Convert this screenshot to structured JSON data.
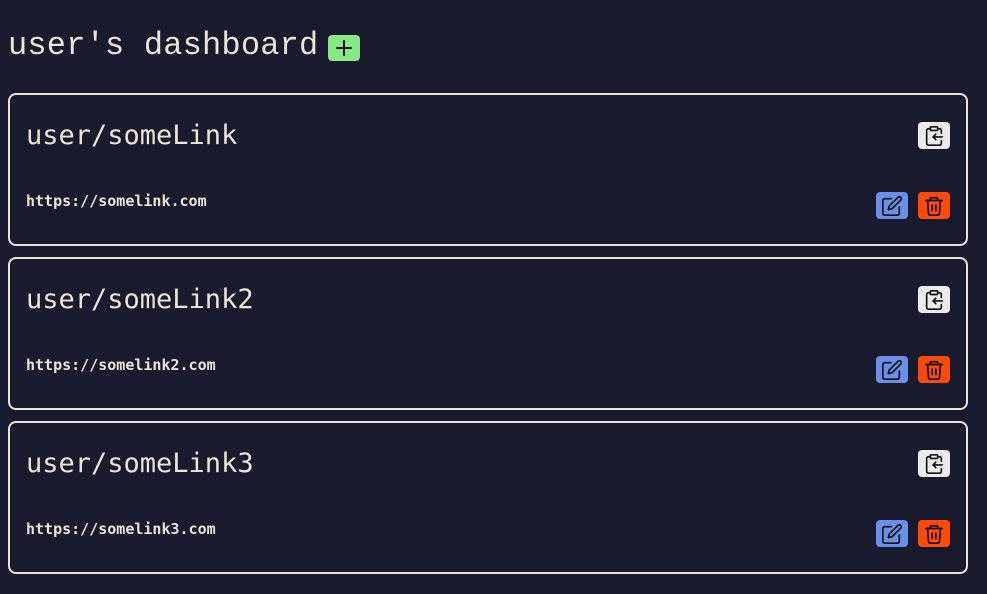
{
  "header": {
    "title": "user's dashboard",
    "add_icon": "plus-icon",
    "add_color": "#86e887"
  },
  "colors": {
    "background": "#1a1a2e",
    "text": "#ece4d4",
    "copy": "#ececec",
    "edit": "#6a8fe8",
    "delete": "#fc4a0a"
  },
  "links": [
    {
      "title": "user/someLink",
      "url": "https://somelink.com"
    },
    {
      "title": "user/someLink2",
      "url": "https://somelink2.com"
    },
    {
      "title": "user/someLink3",
      "url": "https://somelink3.com"
    }
  ],
  "icons": {
    "copy": "clipboard-copy-icon",
    "edit": "edit-icon",
    "delete": "trash-icon"
  }
}
